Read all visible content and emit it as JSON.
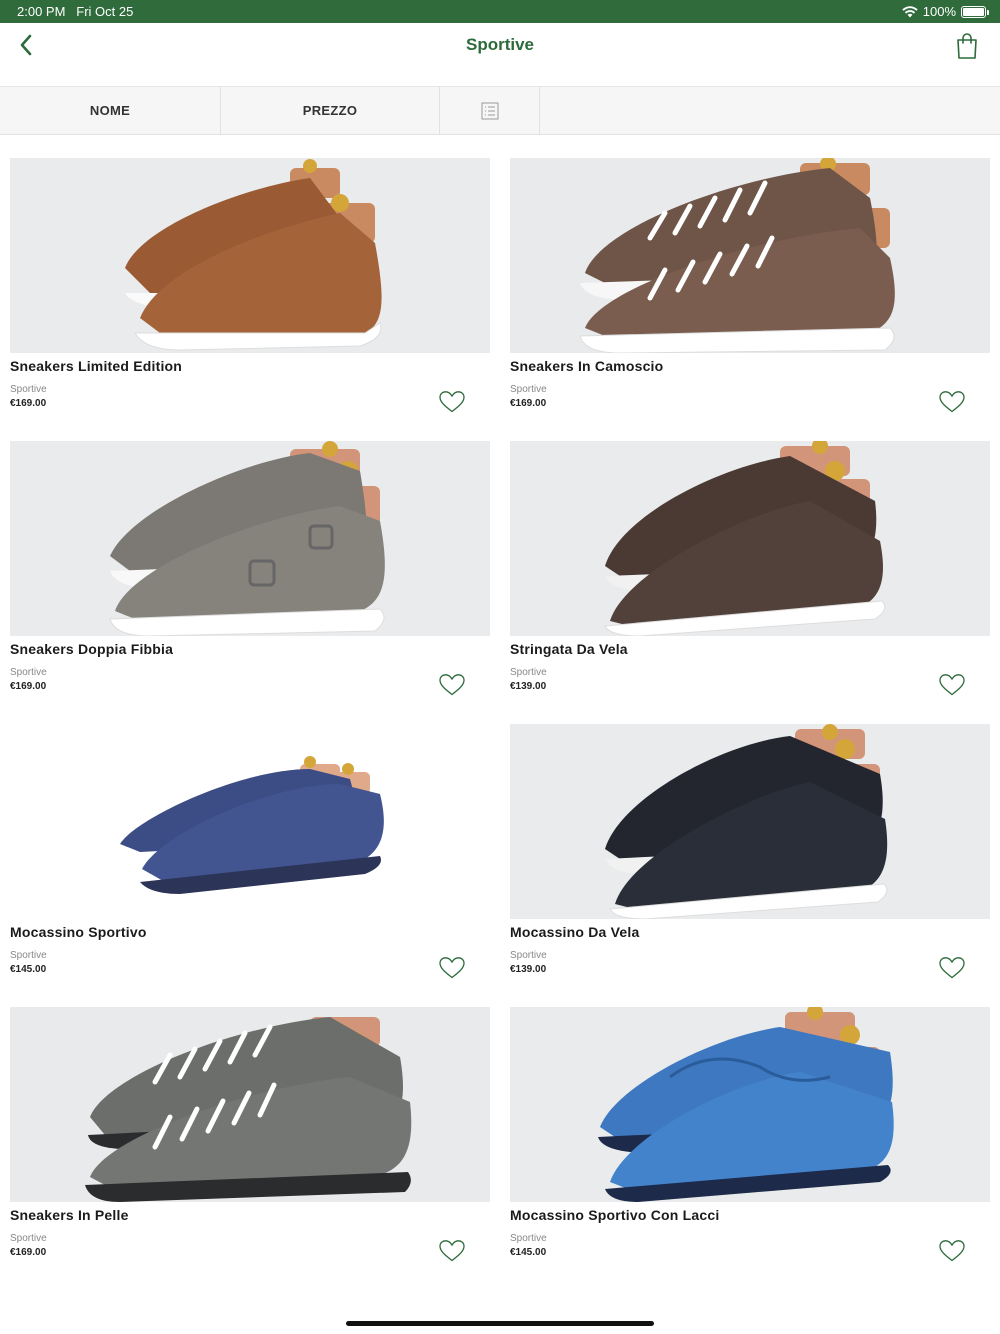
{
  "status_bar": {
    "time": "2:00 PM",
    "date": "Fri Oct 25",
    "battery": "100%"
  },
  "nav": {
    "title": "Sportive",
    "back_icon": "chevron-left-icon",
    "cart_icon": "shopping-bag-icon"
  },
  "sort": {
    "name_label": "NOME",
    "price_label": "PREZZO",
    "view_icon": "list-view-icon"
  },
  "colors": {
    "brand_green": "#2d6b3b",
    "status_bar": "#2f6b3b"
  },
  "products": [
    {
      "name": "Sneakers Limited Edition",
      "category": "Sportive",
      "price": "€169.00"
    },
    {
      "name": "Sneakers In Camoscio",
      "category": "Sportive",
      "price": "€169.00"
    },
    {
      "name": "Sneakers Doppia Fibbia",
      "category": "Sportive",
      "price": "€169.00"
    },
    {
      "name": "Stringata Da Vela",
      "category": "Sportive",
      "price": "€139.00"
    },
    {
      "name": "Mocassino Sportivo",
      "category": "Sportive",
      "price": "€145.00"
    },
    {
      "name": "Mocassino Da Vela",
      "category": "Sportive",
      "price": "€139.00"
    },
    {
      "name": "Sneakers In Pelle",
      "category": "Sportive",
      "price": "€169.00"
    },
    {
      "name": "Mocassino Sportivo Con Lacci",
      "category": "Sportive",
      "price": "€145.00"
    }
  ]
}
